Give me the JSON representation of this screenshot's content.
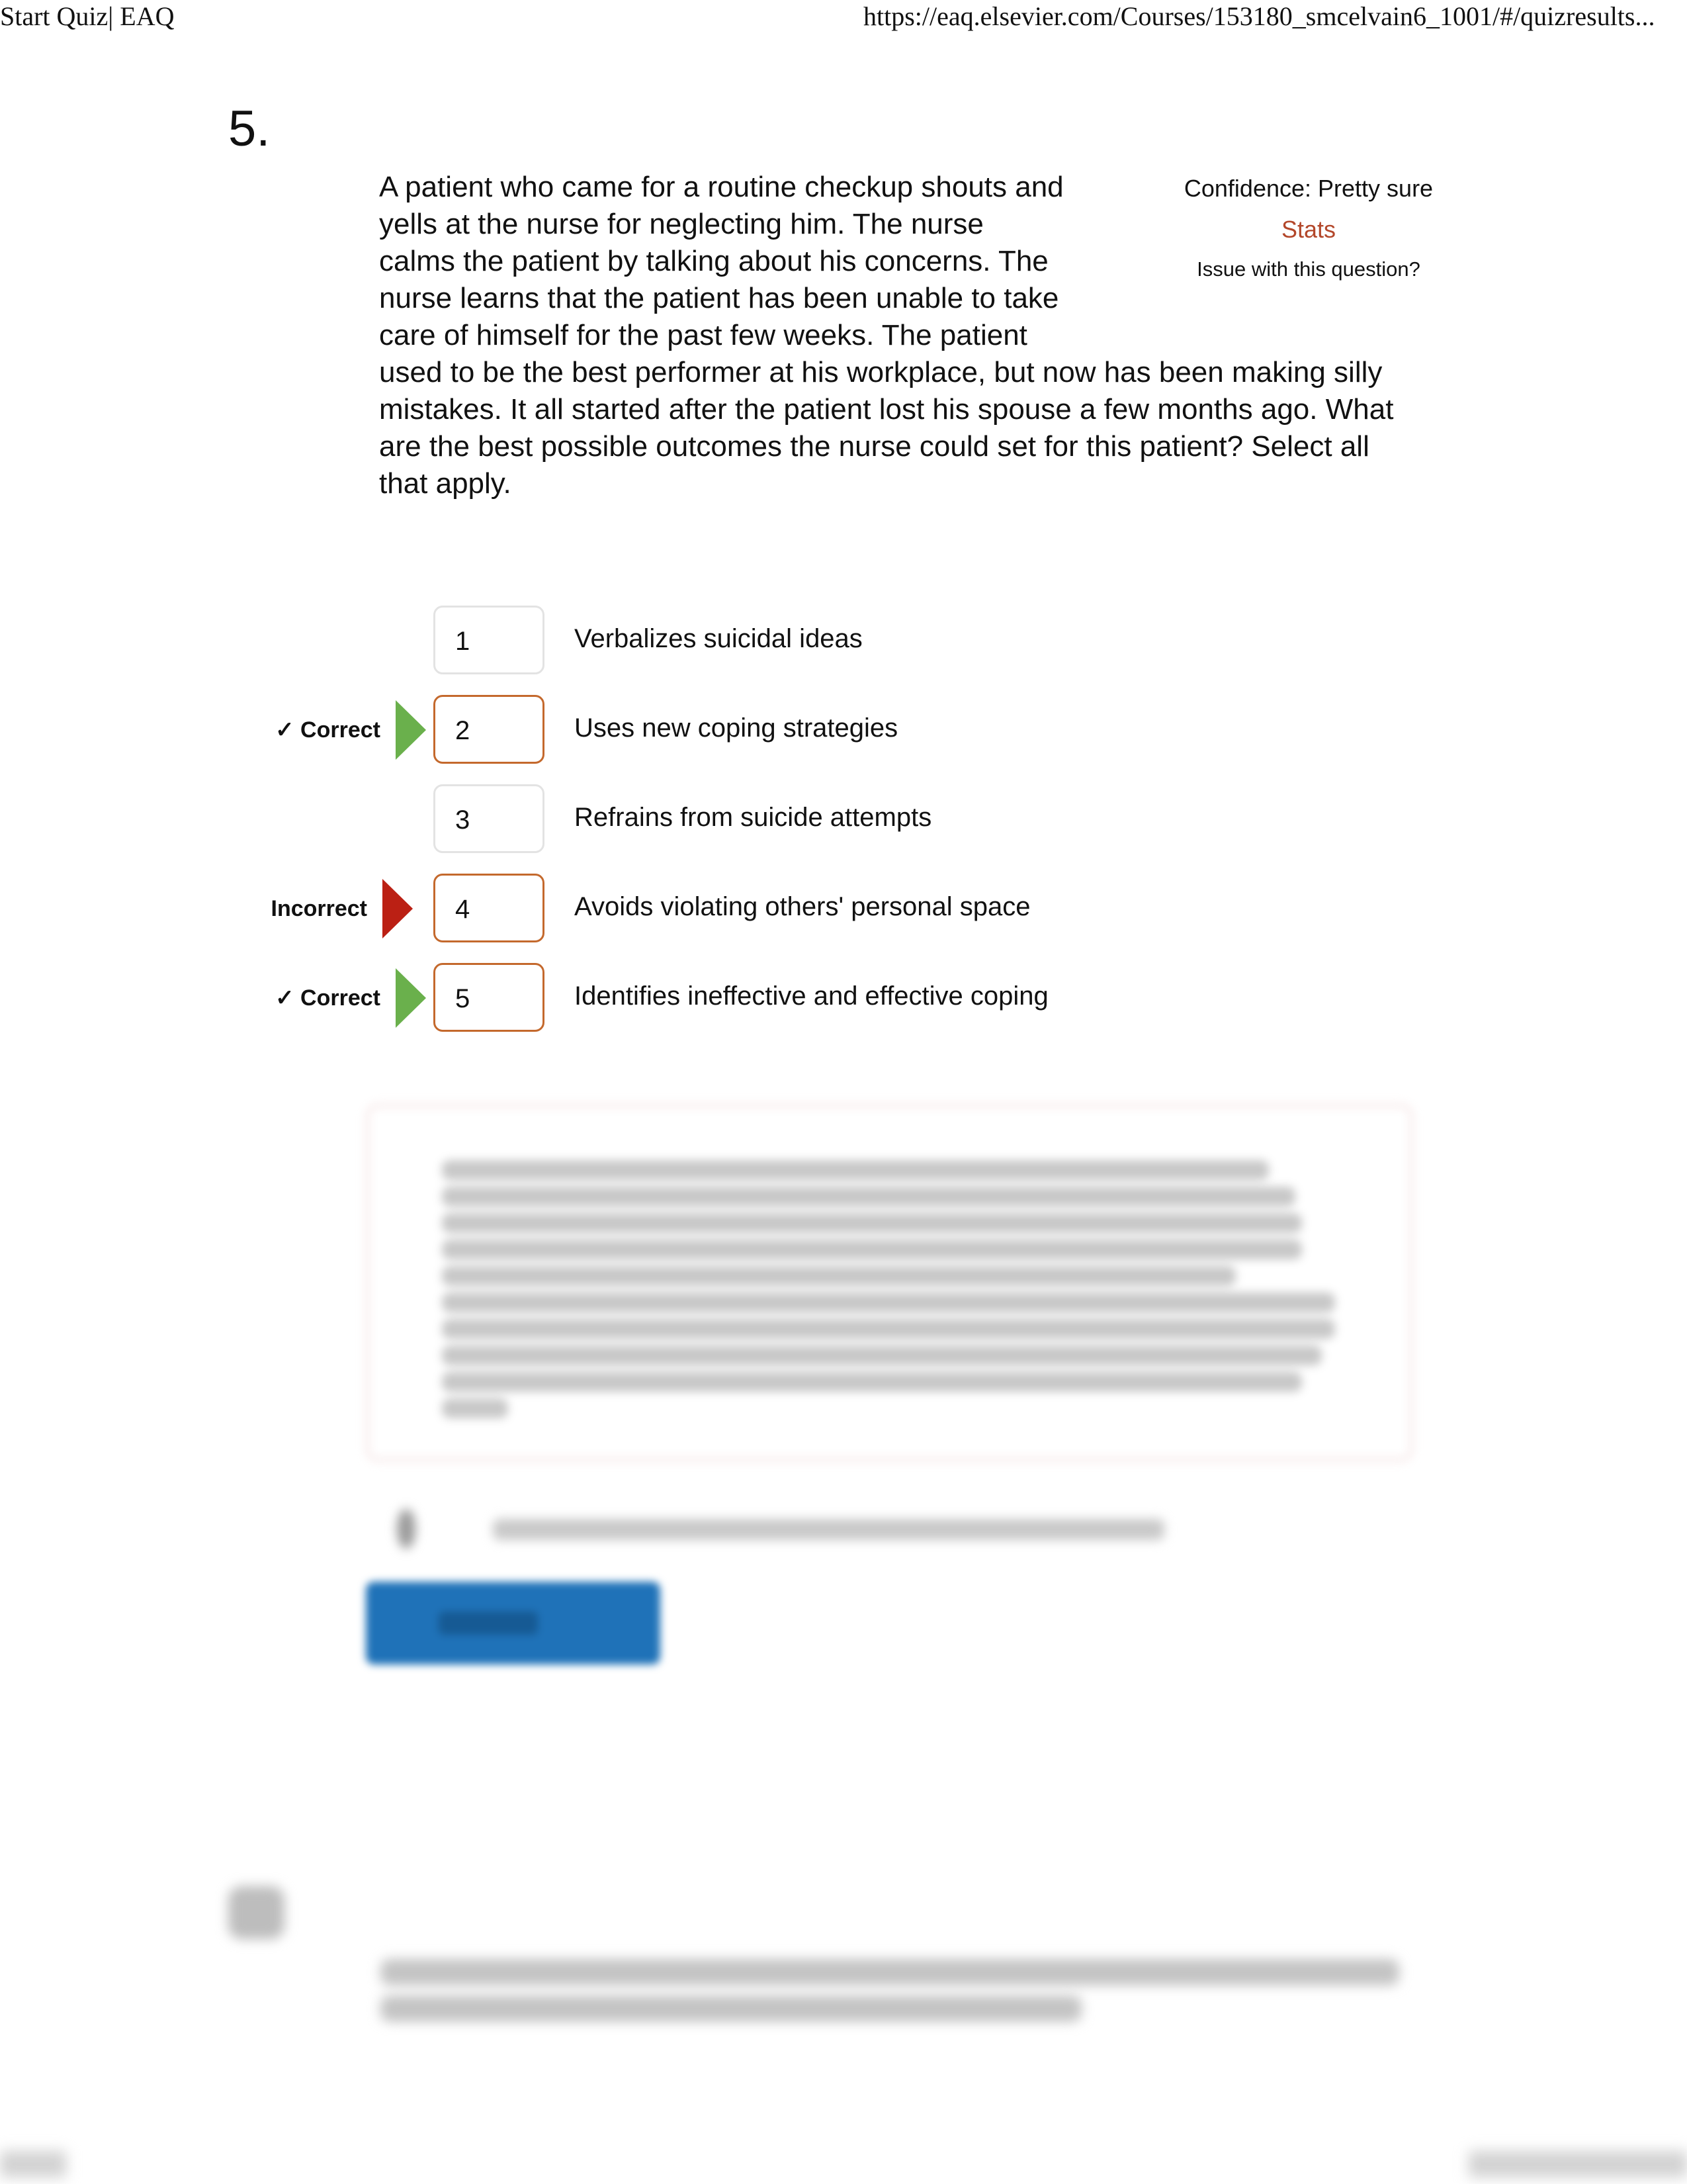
{
  "print_header": {
    "title": "Start Quiz| EAQ",
    "url": "https://eaq.elsevier.com/Courses/153180_smcelvain6_1001/#/quizresults..."
  },
  "question": {
    "number": "5.",
    "text": "A patient who came for a routine checkup shouts and yells at the nurse for neglecting him. The nurse calms the patient by talking about his concerns. The nurse learns that the patient has been unable to take care of himself for the past few weeks. The patient used to be the best performer at his workplace, but now has been making silly mistakes. It all started after the patient lost his spouse a few months ago. What are the best possible outcomes the nurse could set for this patient? Select all that apply."
  },
  "meta": {
    "confidence": "Confidence: Pretty sure",
    "stats_link": "Stats",
    "issue_link": "Issue with this question?"
  },
  "options": [
    {
      "number": "1",
      "text": "Verbalizes suicidal ideas",
      "selected": false,
      "result": ""
    },
    {
      "number": "2",
      "text": "Uses new coping strategies",
      "selected": true,
      "result": "✓ Correct"
    },
    {
      "number": "3",
      "text": "Refrains from suicide attempts",
      "selected": false,
      "result": ""
    },
    {
      "number": "4",
      "text": "Avoids violating others' personal space",
      "selected": true,
      "result": "Incorrect"
    },
    {
      "number": "5",
      "text": "Identifies ineffective and effective coping",
      "selected": true,
      "result": "✓ Correct"
    }
  ],
  "colors": {
    "correct_arrow": "#6ab04c",
    "incorrect_arrow": "#bb2014",
    "selected_border": "#c4692d",
    "stats_link": "#b3472a",
    "primary_button": "#1f72b8"
  }
}
